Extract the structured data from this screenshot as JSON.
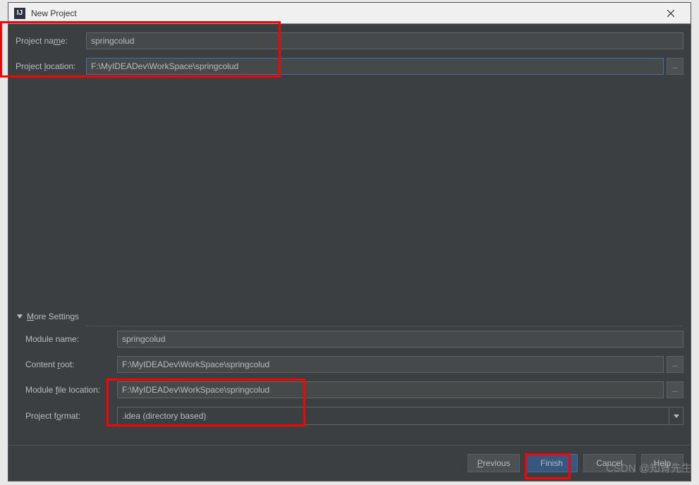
{
  "titlebar": {
    "icon_text": "IJ",
    "title": "New Project"
  },
  "top": {
    "project_name_label": "Project name:",
    "project_name_value": "springcolud",
    "project_location_label": "Project location:",
    "project_location_value": "F:\\MyIDEADev\\WorkSpace\\springcolud",
    "browse": "..."
  },
  "more_settings": {
    "header": "More Settings",
    "module_name_label": "Module name:",
    "module_name_value": "springcolud",
    "content_root_label": "Content root:",
    "content_root_value": "F:\\MyIDEADev\\WorkSpace\\springcolud",
    "module_file_location_label": "Module file location:",
    "module_file_location_value": "F:\\MyIDEADev\\WorkSpace\\springcolud",
    "project_format_label": "Project format:",
    "project_format_value": ".idea (directory based)",
    "browse": "..."
  },
  "buttons": {
    "previous": "Previous",
    "finish": "Finish",
    "cancel": "Cancel",
    "help": "Help"
  },
  "watermark": "CSDN @知青先生"
}
